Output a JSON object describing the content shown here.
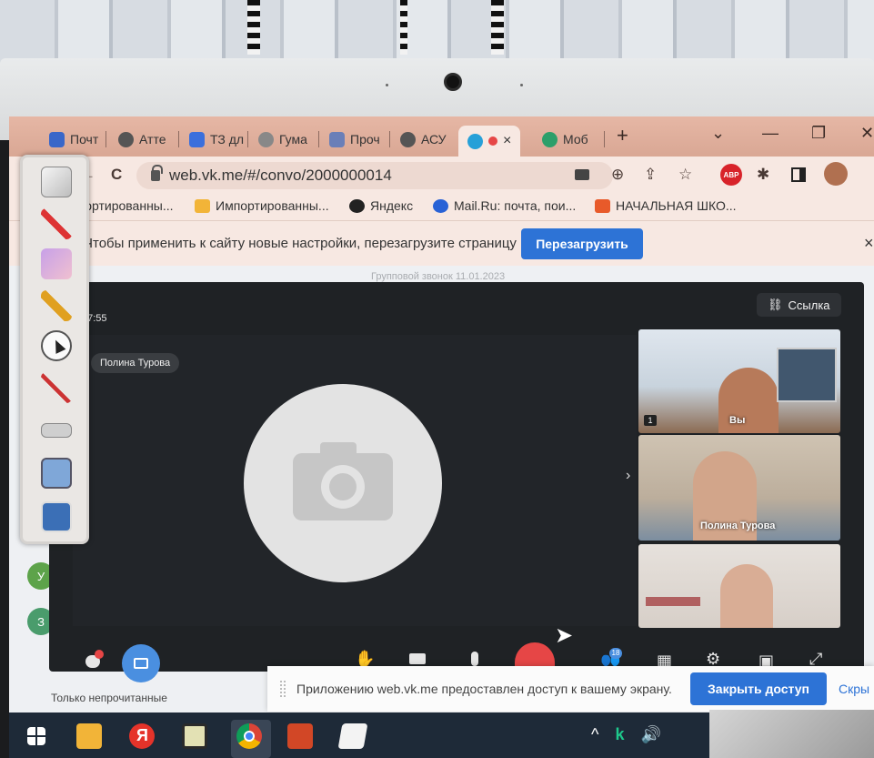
{
  "browser": {
    "tabs": [
      {
        "label": "Почт",
        "color": "#3a67c9"
      },
      {
        "label": "Атте",
        "color": "#555555"
      },
      {
        "label": "ТЗ дл",
        "color": "#3b6fdc"
      },
      {
        "label": "Гума",
        "color": "#888888"
      },
      {
        "label": "Проч",
        "color": "#6a7fb8"
      },
      {
        "label": "АСУ",
        "color": "#555555"
      },
      {
        "label": "",
        "color": "#27a0d8"
      },
      {
        "label": "Моб",
        "color": "#2c9f6a"
      }
    ],
    "active_tab_close": "×",
    "new_tab": "+",
    "window_controls": {
      "menu": "⌄",
      "minimize": "—",
      "restore": "❐",
      "close": "✕"
    },
    "url": "web.vk.me/#/convo/2000000014",
    "nav": {
      "back": "←",
      "reload": "C"
    },
    "toolbar_icons": [
      "camera-icon",
      "zoom-icon",
      "share-icon",
      "star-icon",
      "adblock-icon",
      "extensions-icon",
      "sidepanel-icon",
      "profile-icon"
    ],
    "adblock_label": "ABP"
  },
  "bookmarks": [
    {
      "label": "мпортированны...",
      "color": "#f2b438"
    },
    {
      "label": "Импортированны...",
      "color": "#f2b438"
    },
    {
      "label": "Яндекс",
      "color": "#222222"
    },
    {
      "label": "Mail.Ru: почта, пои...",
      "color": "#2862d6"
    },
    {
      "label": "НАЧАЛЬНАЯ ШКО...",
      "color": "#e85a2a"
    }
  ],
  "infobar": {
    "text": "Чтобы применить к сайту новые настройки, перезагрузите страницу",
    "button": "Перезагрузить",
    "close": "×"
  },
  "call": {
    "header": "Групповой звонок 11.01.2023",
    "timer": "37:55",
    "speaker_name": "Полина Турова",
    "link_button": "Ссылка",
    "participants": [
      {
        "label": "Вы",
        "badge": "1"
      },
      {
        "label": "Полина Турова"
      },
      {
        "label": ""
      }
    ],
    "participants_count": "18"
  },
  "share_notice": {
    "text": "Приложению web.vk.me предоставлен доступ к вашему экрану.",
    "close_button": "Закрыть доступ",
    "hide_link": "Скры"
  },
  "sidebar": {
    "unread_label": "Только непрочитанные",
    "avatars": [
      {
        "letter": "У",
        "color": "#5da34a"
      },
      {
        "letter": "З",
        "color": "#4a9c6c"
      }
    ]
  },
  "taskbar": {
    "apps": [
      "windows-start",
      "file-explorer",
      "yandex-browser",
      "media-app",
      "chrome",
      "powerpoint",
      "whiteboard"
    ],
    "yandex_letter": "Я",
    "tray_icons": [
      "chevron-up-icon",
      "kaspersky-icon",
      "volume-icon"
    ]
  },
  "colors": {
    "accent": "#2d73d6",
    "danger": "#e64646",
    "call_bg": "#1f2225"
  }
}
